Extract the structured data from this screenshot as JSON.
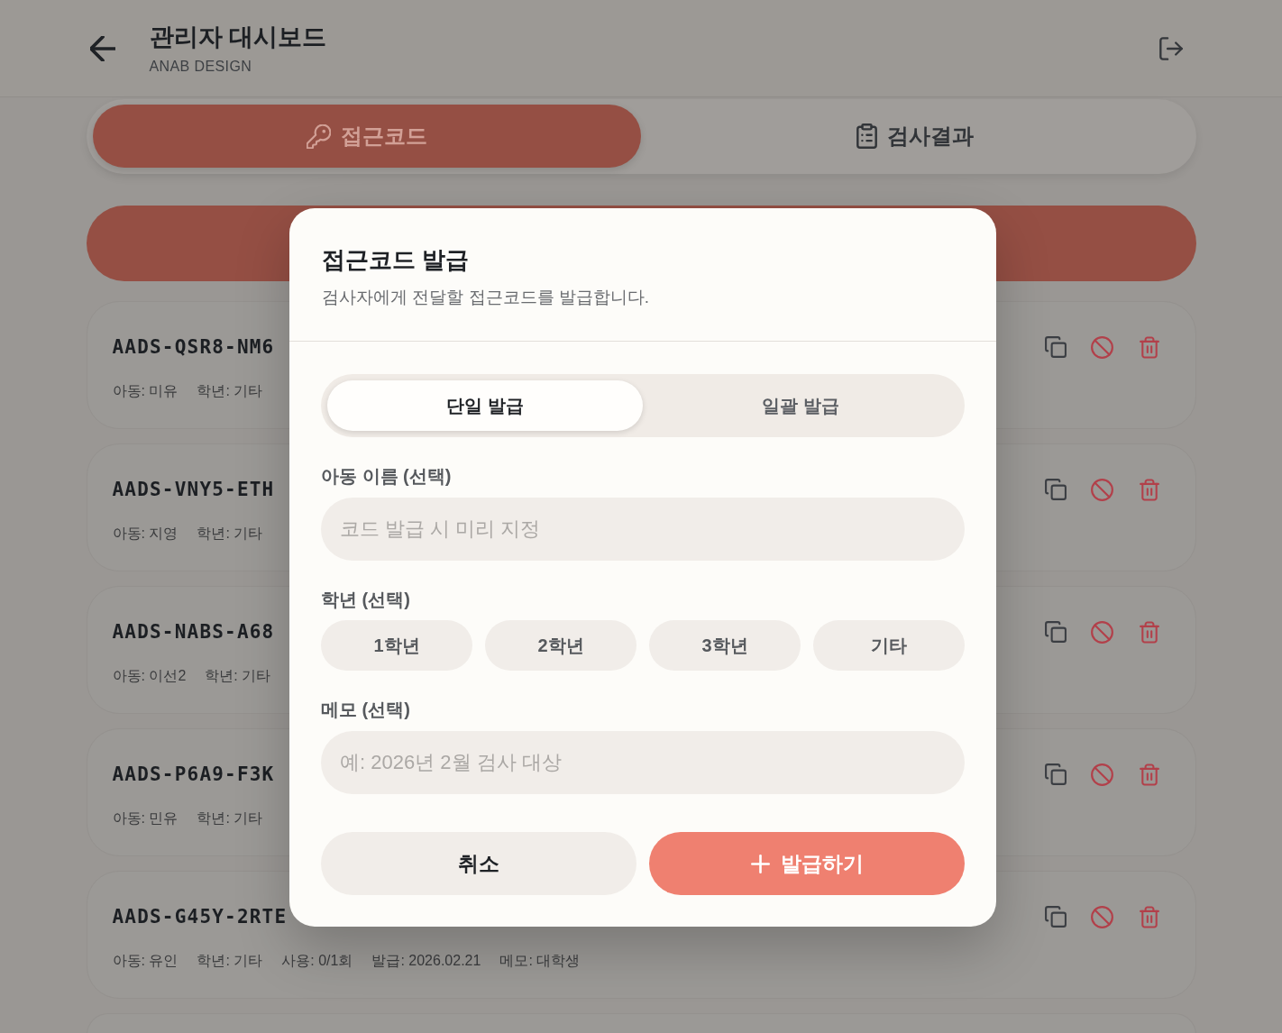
{
  "header": {
    "title": "관리자 대시보드",
    "subtitle": "ANAB DESIGN"
  },
  "tabs": [
    {
      "label": "접근코드",
      "selected": true
    },
    {
      "label": "검사결과",
      "selected": false
    }
  ],
  "codes": [
    {
      "code": "AADS-QSR8-NM6",
      "details": [
        "아동: 미유",
        "학년: 기타"
      ]
    },
    {
      "code": "AADS-VNY5-ETH",
      "details": [
        "아동: 지영",
        "학년: 기타"
      ]
    },
    {
      "code": "AADS-NABS-A68",
      "details": [
        "아동: 이선2",
        "학년: 기타"
      ]
    },
    {
      "code": "AADS-P6A9-F3K",
      "details": [
        "아동: 민유",
        "학년: 기타"
      ]
    },
    {
      "code": "AADS-G45Y-2RTE",
      "details": [
        "아동: 유인",
        "학년: 기타",
        "사용: 0/1회",
        "발급: 2026.02.21",
        "메모: 대학생"
      ]
    }
  ],
  "dialog": {
    "title": "접근코드 발급",
    "description": "검사자에게 전달할 접근코드를 발급합니다.",
    "modes": [
      {
        "label": "단일 발급",
        "selected": true
      },
      {
        "label": "일괄 발급",
        "selected": false
      }
    ],
    "child_name": {
      "label": "아동 이름 (선택)",
      "placeholder": "코드 발급 시 미리 지정"
    },
    "grade": {
      "label": "학년 (선택)",
      "options": [
        {
          "label": "1학년",
          "selected": false
        },
        {
          "label": "2학년",
          "selected": false
        },
        {
          "label": "3학년",
          "selected": false
        },
        {
          "label": "기타",
          "selected": false
        }
      ]
    },
    "memo": {
      "label": "메모 (선택)",
      "placeholder": "예: 2026년 2월 검사 대상"
    },
    "buttons": [
      {
        "label": "취소",
        "kind": "cancel"
      },
      {
        "label": "발급하기",
        "kind": "submit"
      }
    ]
  }
}
